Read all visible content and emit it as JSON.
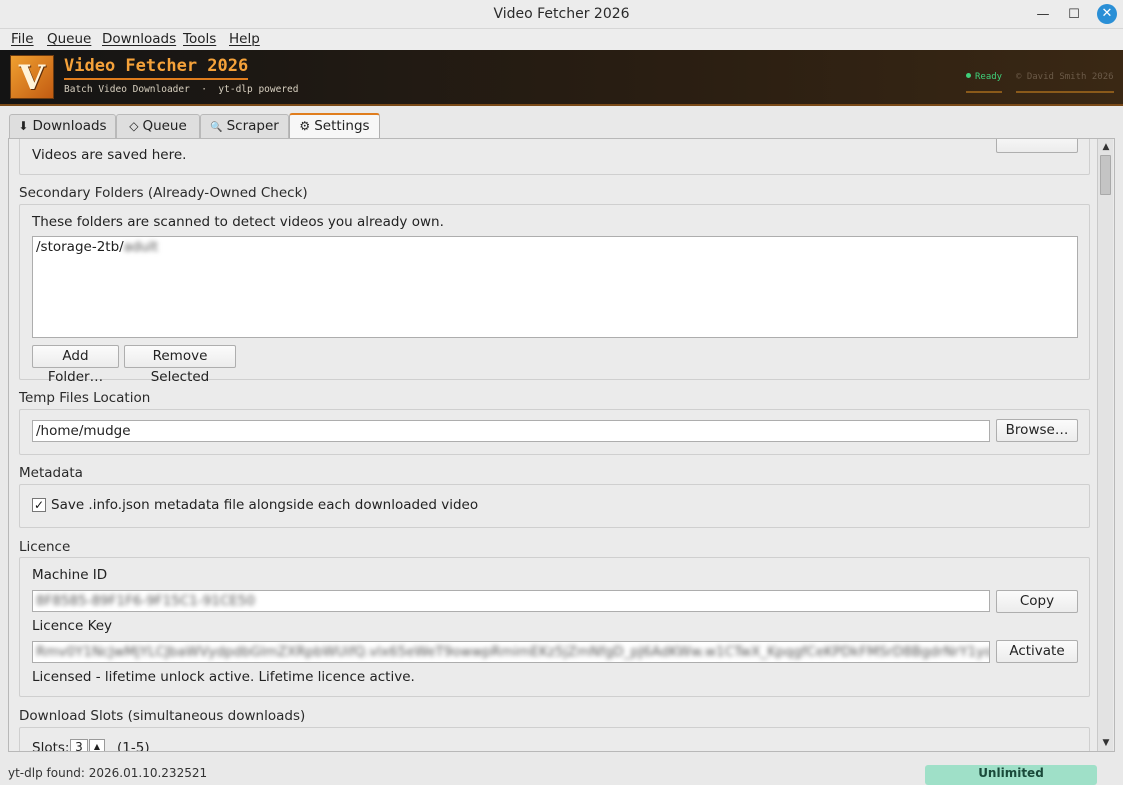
{
  "window": {
    "title": "Video Fetcher 2026",
    "minimize_glyph": "—",
    "maximize_glyph": "☐",
    "close_glyph": "✕"
  },
  "menu": {
    "file": "File",
    "queue": "Queue",
    "downloads": "Downloads",
    "tools": "Tools",
    "help": "Help"
  },
  "banner": {
    "logo_letter": "V",
    "app_name": "Video Fetcher 2026",
    "subtitle": "Batch Video Downloader  ·  yt-dlp powered",
    "status": "Ready",
    "copyright": "© David Smith 2026",
    "accent_color": "#e07d1d",
    "status_color": "#3fd07a"
  },
  "tabs": [
    {
      "icon": "⬇",
      "label": "Downloads"
    },
    {
      "icon": "◇",
      "label": "Queue"
    },
    {
      "icon": "🔍",
      "label": "Scraper"
    },
    {
      "icon": "⚙",
      "label": "Settings",
      "active": true
    }
  ],
  "settings": {
    "download_folder_note": "Videos are saved here.",
    "secondary_title": "Secondary Folders (Already-Owned Check)",
    "secondary_note": "These folders are scanned to detect videos you already own.",
    "secondary_folders": [
      {
        "path": "/storage-2tb/",
        "hidden": "adult"
      }
    ],
    "add_folder_label": "Add Folder…",
    "remove_selected_label": "Remove Selected",
    "temp_title": "Temp Files Location",
    "temp_path": "/home/mudge",
    "browse_label": "Browse…",
    "metadata_title": "Metadata",
    "metadata_checkbox_label": "Save .info.json metadata file alongside each downloaded video",
    "metadata_checked": true,
    "licence_title": "Licence",
    "machine_id_label": "Machine ID",
    "machine_id_value": "8F8585-89F1F6-9F15C1-91CE50",
    "copy_label": "Copy",
    "licence_key_label": "Licence Key",
    "licence_key_value": "Rmv0Y1NcJwMjYLCJbaWVydpdbGlmZXRpbWUifQ.vlx65eWeT9owwpRmimEKz5jZmNfgD_pJ6AdKWw.w1CTwX_KpqgfCeKPDkFMSrD8BgdrNrY1yoiP_KumC1JCBg",
    "activate_label": "Activate",
    "licence_status": "Licensed - lifetime unlock active. Lifetime licence active.",
    "slots_title": "Download Slots (simultaneous downloads)",
    "slots_label": "Slots:",
    "slots_value": "3",
    "slots_range": "(1-5)"
  },
  "statusbar": {
    "text": "yt-dlp found: 2026.01.10.232521",
    "pill": "Unlimited"
  }
}
